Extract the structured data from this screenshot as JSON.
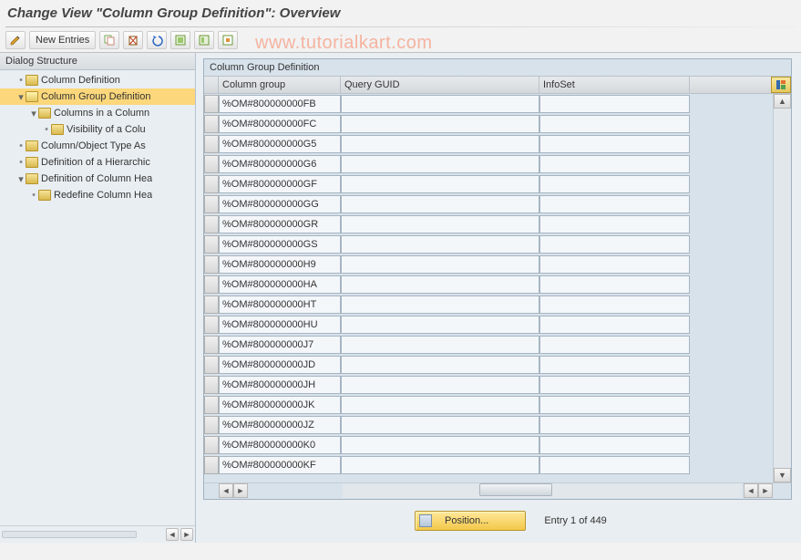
{
  "title": "Change View \"Column Group Definition\": Overview",
  "watermark": "www.tutorialkart.com",
  "toolbar": {
    "new_entries_label": "New Entries"
  },
  "dialog_structure": {
    "header": "Dialog Structure",
    "items": [
      {
        "label": "Column Definition",
        "indent": 1,
        "toggle": "leaf",
        "open": false,
        "selected": false
      },
      {
        "label": "Column Group Definition",
        "indent": 1,
        "toggle": "open",
        "open": true,
        "selected": true
      },
      {
        "label": "Columns in a Column",
        "indent": 2,
        "toggle": "open",
        "open": false,
        "selected": false
      },
      {
        "label": "Visibility of a Colu",
        "indent": 3,
        "toggle": "leaf",
        "open": false,
        "selected": false
      },
      {
        "label": "Column/Object Type As",
        "indent": 1,
        "toggle": "leaf",
        "open": false,
        "selected": false
      },
      {
        "label": "Definition of a Hierarchic",
        "indent": 1,
        "toggle": "leaf",
        "open": false,
        "selected": false
      },
      {
        "label": "Definition of Column Hea",
        "indent": 1,
        "toggle": "open",
        "open": false,
        "selected": false
      },
      {
        "label": "Redefine Column Hea",
        "indent": 2,
        "toggle": "leaf",
        "open": false,
        "selected": false
      }
    ]
  },
  "table": {
    "title": "Column Group Definition",
    "columns": {
      "colgroup": "Column group",
      "guid": "Query GUID",
      "infoset": "InfoSet"
    },
    "rows": [
      {
        "colgroup": "%OM#800000000FB",
        "guid": "",
        "infoset": ""
      },
      {
        "colgroup": "%OM#800000000FC",
        "guid": "",
        "infoset": ""
      },
      {
        "colgroup": "%OM#800000000G5",
        "guid": "",
        "infoset": ""
      },
      {
        "colgroup": "%OM#800000000G6",
        "guid": "",
        "infoset": ""
      },
      {
        "colgroup": "%OM#800000000GF",
        "guid": "",
        "infoset": ""
      },
      {
        "colgroup": "%OM#800000000GG",
        "guid": "",
        "infoset": ""
      },
      {
        "colgroup": "%OM#800000000GR",
        "guid": "",
        "infoset": ""
      },
      {
        "colgroup": "%OM#800000000GS",
        "guid": "",
        "infoset": ""
      },
      {
        "colgroup": "%OM#800000000H9",
        "guid": "",
        "infoset": ""
      },
      {
        "colgroup": "%OM#800000000HA",
        "guid": "",
        "infoset": ""
      },
      {
        "colgroup": "%OM#800000000HT",
        "guid": "",
        "infoset": ""
      },
      {
        "colgroup": "%OM#800000000HU",
        "guid": "",
        "infoset": ""
      },
      {
        "colgroup": "%OM#800000000J7",
        "guid": "",
        "infoset": ""
      },
      {
        "colgroup": "%OM#800000000JD",
        "guid": "",
        "infoset": ""
      },
      {
        "colgroup": "%OM#800000000JH",
        "guid": "",
        "infoset": ""
      },
      {
        "colgroup": "%OM#800000000JK",
        "guid": "",
        "infoset": ""
      },
      {
        "colgroup": "%OM#800000000JZ",
        "guid": "",
        "infoset": ""
      },
      {
        "colgroup": "%OM#800000000K0",
        "guid": "",
        "infoset": ""
      },
      {
        "colgroup": "%OM#800000000KF",
        "guid": "",
        "infoset": ""
      }
    ]
  },
  "footer": {
    "position_label": "Position...",
    "entry_text": "Entry 1 of 449"
  }
}
